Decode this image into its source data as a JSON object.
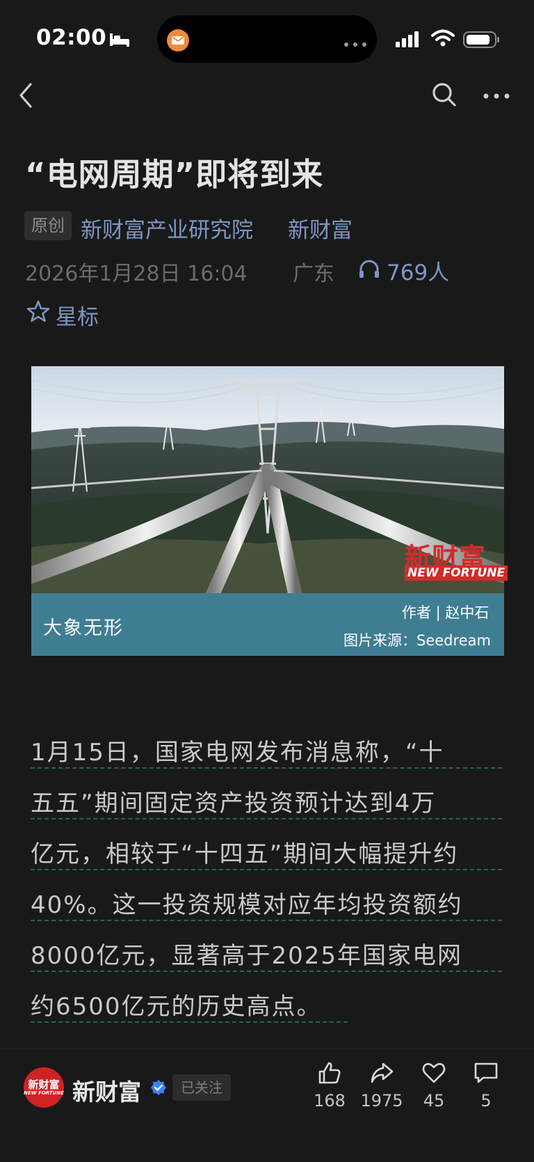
{
  "status_bar": {
    "time": "02:00"
  },
  "article": {
    "title": "“电网周期”即将到来",
    "original_badge": "原创",
    "source_primary": "新财富产业研究院",
    "source_secondary": "新财富",
    "date": "2026年1月28日 16:04",
    "location": "广东",
    "listen_count": "769人",
    "star_label": "星标"
  },
  "cover": {
    "banner_title": "大象无形",
    "author": "作者 | 赵中石",
    "image_credit": "图片来源：Seedream",
    "brand_cn": "新财富",
    "brand_en": "NEW FORTUNE"
  },
  "paragraph": {
    "lines": [
      "1月15日，国家电网发布消息称，“十",
      "五五”期间固定资产投资预计达到4万",
      "亿元，相较于“十四五”期间大幅提升约",
      "40%。这一投资规模对应年均投资额约",
      "8000亿元，显著高于2025年国家电网",
      "约6500亿元的历史高点。"
    ]
  },
  "bottom_bar": {
    "account_name": "新财富",
    "avatar_cn": "新财富",
    "avatar_en": "NEW FORTUNE",
    "follow_status": "已关注",
    "actions": [
      {
        "icon": "thumbs-up-icon",
        "count": "168"
      },
      {
        "icon": "share-icon",
        "count": "1975"
      },
      {
        "icon": "heart-icon",
        "count": "45"
      },
      {
        "icon": "comment-icon",
        "count": "5"
      }
    ]
  },
  "colors": {
    "background": "#191919",
    "link_blue": "#7d96c4",
    "banner_teal": "#3f7d93",
    "brand_red": "#d42a2a",
    "underline_green": "#1f6b43"
  }
}
